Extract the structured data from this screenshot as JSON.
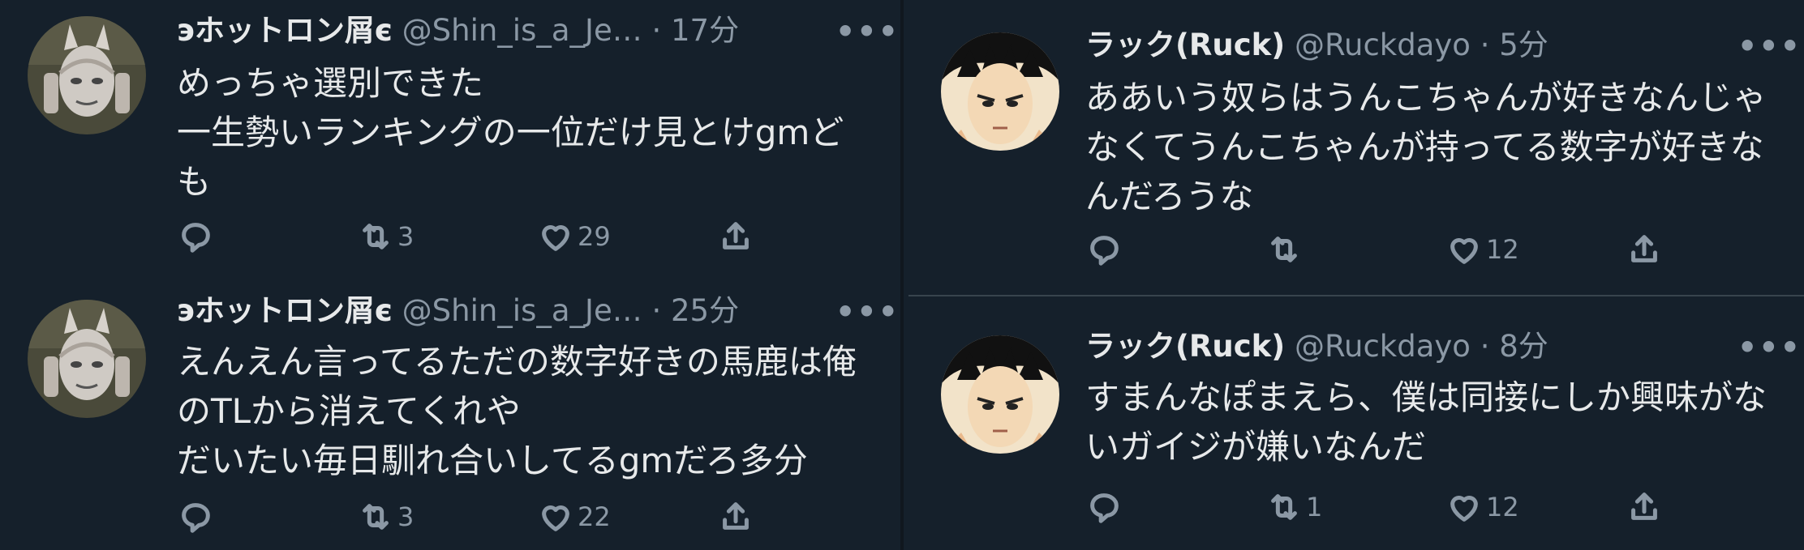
{
  "tweets": [
    {
      "name": "эホットロン屑є",
      "handle": "@Shin_is_a_Je…",
      "time": "· 17分",
      "more": "•••",
      "lines": [
        "めっちゃ選別できた",
        "一生勢いランキングの一位だけ見とけgmど",
        "も"
      ],
      "reply": "",
      "retweet": "3",
      "like": "29",
      "avatar_icon": "white-alien-avatar"
    },
    {
      "name": "эホットロン屑є",
      "handle": "@Shin_is_a_Je…",
      "time": "· 25分",
      "more": "•••",
      "lines": [
        "えんえん言ってるただの数字好きの馬鹿は俺",
        "のTLから消えてくれや",
        "だいたい毎日馴れ合いしてるgmだろ多分"
      ],
      "reply": "",
      "retweet": "3",
      "like": "22",
      "avatar_icon": "white-alien-avatar"
    },
    {
      "name": "ラック(Ruck)",
      "handle": "@Ruckdayo",
      "time": "· 5分",
      "more": "•••",
      "lines": [
        "ああいう奴らはうんこちゃんが好きなんじゃ",
        "なくてうんこちゃんが持ってる数字が好きな",
        "んだろうな"
      ],
      "reply": "",
      "retweet": "",
      "like": "12",
      "avatar_icon": "anime-face-avatar"
    },
    {
      "name": "ラック(Ruck)",
      "handle": "@Ruckdayo",
      "time": "· 8分",
      "more": "•••",
      "lines": [
        "すまんなぽまえら、僕は同接にしか興味がな",
        "いガイジが嫌いなんだ"
      ],
      "reply": "",
      "retweet": "1",
      "like": "12",
      "avatar_icon": "anime-face-avatar"
    }
  ],
  "colors": {
    "background": "#15202b",
    "text": "#e7e9ea",
    "muted": "#8b98a5"
  }
}
